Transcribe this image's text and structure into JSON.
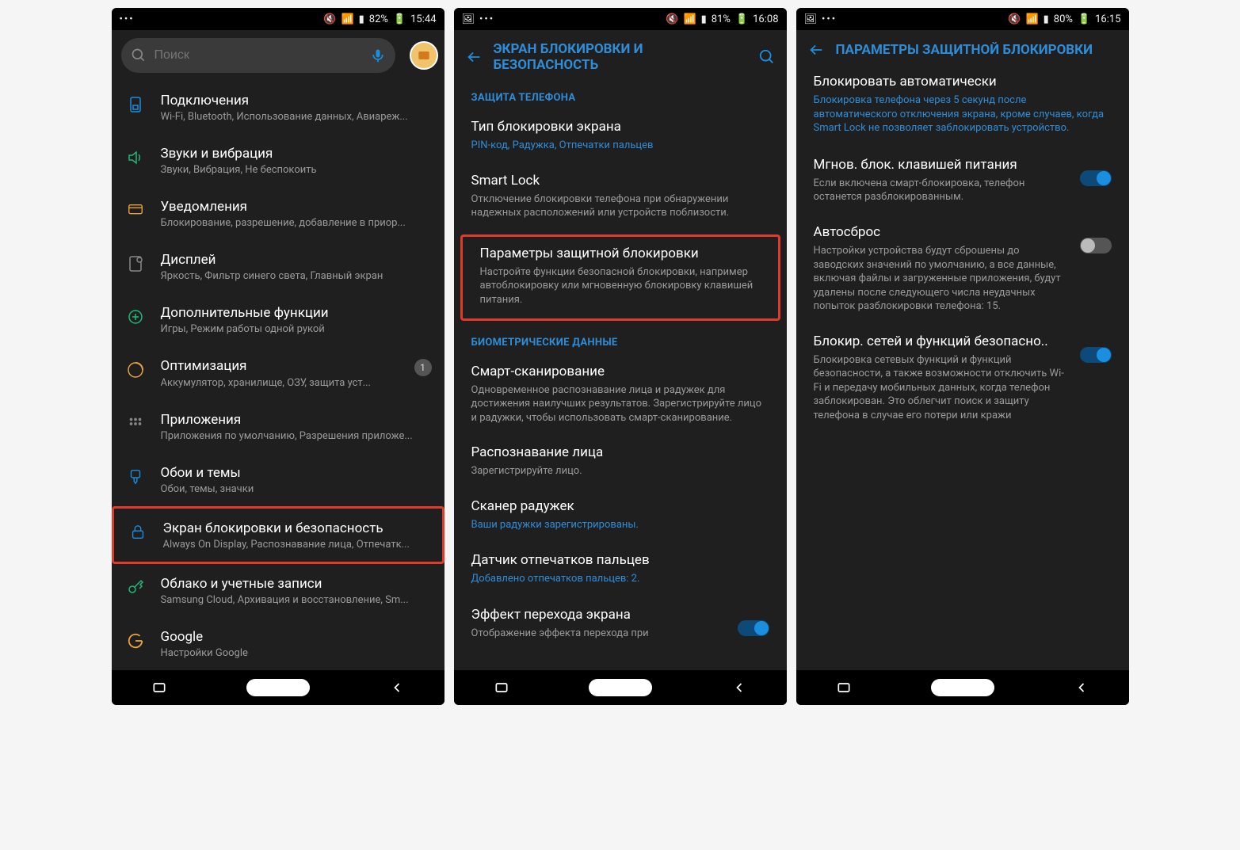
{
  "phone1": {
    "status": {
      "battery": "82%",
      "time": "15:44"
    },
    "search": {
      "placeholder": "Поиск"
    },
    "items": [
      {
        "icon": "sim",
        "title": "Подключения",
        "sub": "Wi-Fi, Bluetooth, Использование данных, Авиареж..."
      },
      {
        "icon": "sound",
        "title": "Звуки и вибрация",
        "sub": "Звуки, Вибрация, Не беспокоить"
      },
      {
        "icon": "notif",
        "title": "Уведомления",
        "sub": "Блокирование, разрешение, добавление в приор..."
      },
      {
        "icon": "display",
        "title": "Дисплей",
        "sub": "Яркость, Фильтр синего света, Главный экран"
      },
      {
        "icon": "plus",
        "title": "Дополнительные функции",
        "sub": "Игры, Режим работы одной рукой"
      },
      {
        "icon": "optimize",
        "title": "Оптимизация",
        "sub": "Аккумулятор, хранилище, ОЗУ, защита уст...",
        "badge": "1"
      },
      {
        "icon": "apps",
        "title": "Приложения",
        "sub": "Приложения по умолчанию, Разрешения приложе..."
      },
      {
        "icon": "wall",
        "title": "Обои и темы",
        "sub": "Обои, темы, значки"
      },
      {
        "icon": "lock",
        "title": "Экран блокировки и безопасность",
        "sub": "Always On Display, Распознавание лица, Отпечатк...",
        "highlight": true
      },
      {
        "icon": "cloud",
        "title": "Облако и учетные записи",
        "sub": "Samsung Cloud, Архивация и восстановление, Sm..."
      },
      {
        "icon": "google",
        "title": "Google",
        "sub": "Настройки Google"
      }
    ]
  },
  "phone2": {
    "status": {
      "battery": "81%",
      "time": "16:08"
    },
    "title": "ЭКРАН БЛОКИРОВКИ И БЕЗОПАСНОСТЬ",
    "sections": [
      {
        "header": "ЗАЩИТА ТЕЛЕФОНА",
        "items": [
          {
            "title": "Тип блокировки экрана",
            "sub": "PIN-код, Радужка, Отпечатки пальцев",
            "accent": true
          },
          {
            "title": "Smart Lock",
            "sub": "Отключение блокировки телефона при обнаружении надежных расположений или устройств поблизости."
          },
          {
            "title": "Параметры защитной блокировки",
            "sub": "Настройте функции безопасной блокировки, например автоблокировку или мгновенную блокировку клавишей питания.",
            "highlight": true
          }
        ]
      },
      {
        "header": "БИОМЕТРИЧЕСКИЕ ДАННЫЕ",
        "items": [
          {
            "title": "Смарт-сканирование",
            "sub": "Одновременное распознавание лица и радужек для достижения наилучших результатов. Зарегистрируйте лицо и радужки, чтобы использовать смарт-сканирование."
          },
          {
            "title": "Распознавание лица",
            "sub": "Зарегистрируйте лицо."
          },
          {
            "title": "Сканер радужек",
            "sub": "Ваши радужки зарегистрированы.",
            "accent": true
          },
          {
            "title": "Датчик отпечатков пальцев",
            "sub": "Добавлено отпечатков пальцев: 2.",
            "accent": true
          },
          {
            "title": "Эффект перехода экрана",
            "sub": "Отображение эффекта перехода при",
            "toggle": "on"
          }
        ]
      }
    ]
  },
  "phone3": {
    "status": {
      "battery": "80%",
      "time": "16:15"
    },
    "title": "ПАРАМЕТРЫ ЗАЩИТНОЙ БЛОКИРОВКИ",
    "items": [
      {
        "title": "Блокировать автоматически",
        "sub": "Блокировка телефона через 5 секунд после автоматического отключения экрана, кроме случаев, когда Smart Lock не позволяет заблокировать устройство.",
        "accent": true
      },
      {
        "title": "Мгнов. блок. клавишей питания",
        "sub": "Если включена смарт-блокировка, телефон останется разблокированным.",
        "toggle": "on"
      },
      {
        "title": "Автосброс",
        "sub": "Настройки устройства будут сброшены до заводских значений по умолчанию, а все данные, включая файлы и загруженные приложения, будут удалены после следующего числа неудачных попыток разблокировки телефона: 15.",
        "toggle": "off"
      },
      {
        "title": "Блокир. сетей и функций безопасно..",
        "sub": "Блокировка сетевых функций и функций безопасности, а также возможности отключить Wi-Fi и передачу мобильных данных, когда телефон заблокирован. Это облегчит поиск и защиту телефона в случае его потери или кражи",
        "toggle": "on"
      }
    ]
  }
}
